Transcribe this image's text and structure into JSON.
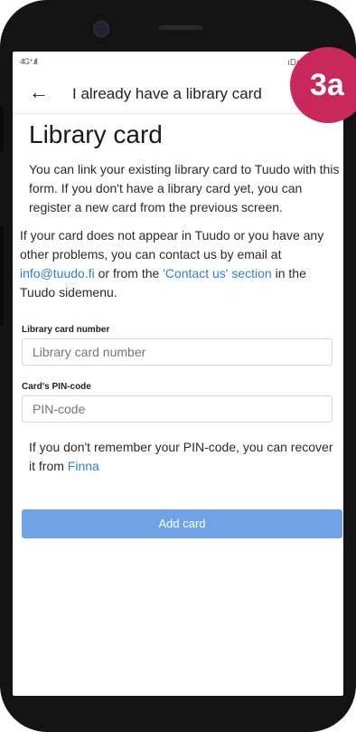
{
  "status": {
    "signal": "4G⁺.ıll",
    "right": "ıDı 100 ⚡ 12"
  },
  "appbar": {
    "back_icon": "←",
    "title": "I already have a library card"
  },
  "badge": {
    "text": "3a",
    "color": "#c8285a"
  },
  "page": {
    "title": "Library card",
    "intro": "You can link your existing library card to Tuudo with this form. If you don't have a library card yet, you can register a new card from the previous screen.",
    "help_part1": "If your card does not appear in Tuudo or you have any other problems, you can contact us by email at ",
    "help_email": "info@tuudo.fi",
    "help_part2": " or from the ",
    "help_contact_link": "'Contact us' section",
    "help_part3": " in the Tuudo sidemenu."
  },
  "form": {
    "card_number_label": "Library card number",
    "card_number_placeholder": "Library card number",
    "card_number_value": "",
    "pin_label": "Card's PIN-code",
    "pin_placeholder": "PIN-code",
    "pin_value": "",
    "recover_text": "If you don't remember your PIN-code, you can recover it from ",
    "recover_link": "Finna",
    "submit_label": "Add card"
  },
  "colors": {
    "link": "#2f80d6",
    "button": "#6fa3e6",
    "badge": "#c8285a"
  }
}
